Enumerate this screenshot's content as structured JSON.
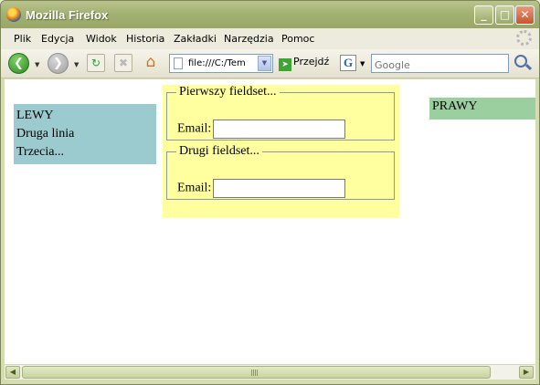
{
  "window": {
    "title": "Mozilla Firefox",
    "controls": {
      "minimize": "_",
      "maximize": "□",
      "close": "✕"
    }
  },
  "menu": {
    "items": [
      "Plik",
      "Edycja",
      "Widok",
      "Historia",
      "Zakładki",
      "Narzędzia",
      "Pomoc"
    ]
  },
  "toolbar": {
    "url": "file:///C:/Tem",
    "go_label": "Przejdź",
    "search_engine": "G",
    "search_placeholder": "Google"
  },
  "page": {
    "left_box": {
      "lines": [
        "LEWY",
        "Druga linia",
        "Trzecia..."
      ]
    },
    "fieldsets": [
      {
        "legend": "Pierwszy fieldset...",
        "field_label": "Email:",
        "field_value": ""
      },
      {
        "legend": "Drugi fieldset...",
        "field_label": "Email:",
        "field_value": ""
      }
    ],
    "right_box": {
      "text": "PRAWY"
    }
  },
  "colors": {
    "title_bar": "#a2b072",
    "left_box_bg": "#9ccbcf",
    "middle_box_bg": "#ffff9f",
    "right_box_bg": "#9ccfa0"
  },
  "icons": {
    "back": "back-arrow-icon",
    "forward": "forward-arrow-icon",
    "reload": "reload-icon",
    "stop": "stop-icon",
    "home": "home-icon",
    "search": "magnifier-icon"
  }
}
